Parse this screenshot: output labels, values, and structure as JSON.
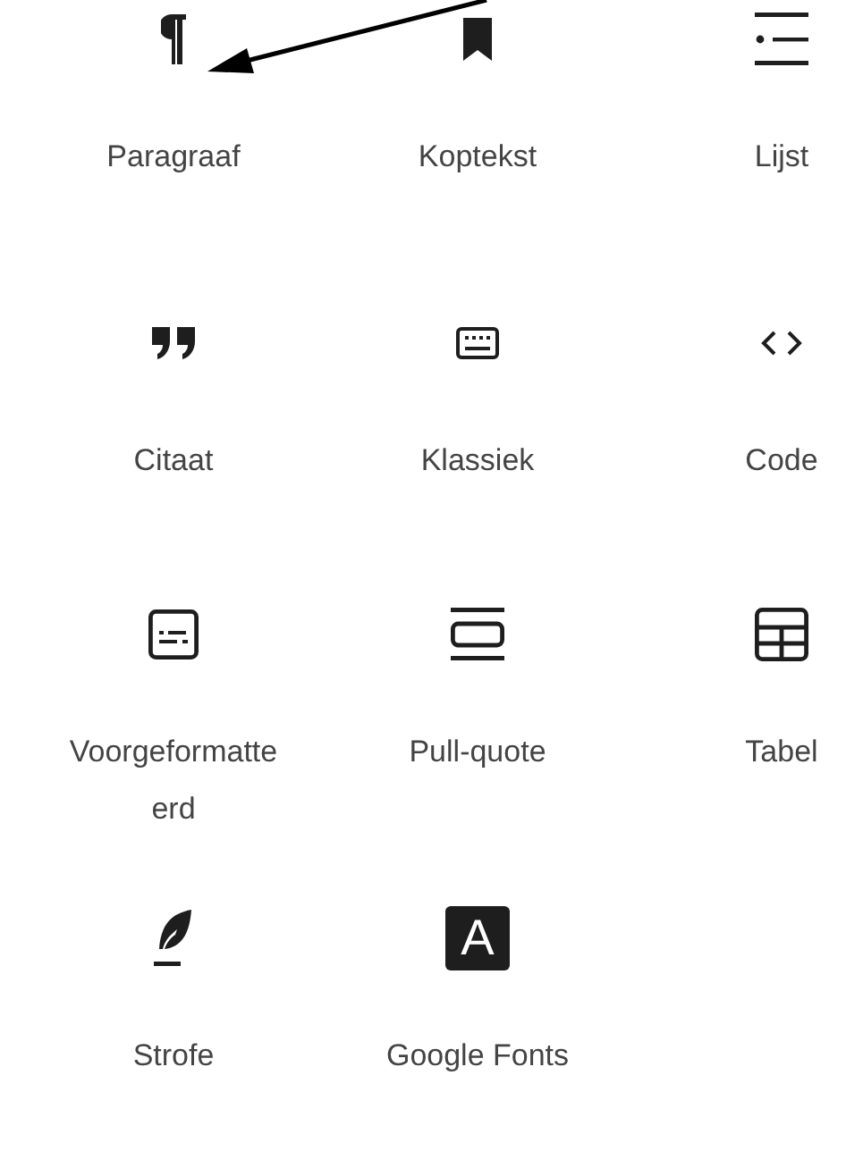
{
  "blocks": [
    {
      "kind": "paragraph",
      "label": "Paragraaf"
    },
    {
      "kind": "heading",
      "label": "Koptekst"
    },
    {
      "kind": "list",
      "label": "Lijst"
    },
    {
      "kind": "quote",
      "label": "Citaat"
    },
    {
      "kind": "classic",
      "label": "Klassiek"
    },
    {
      "kind": "code",
      "label": "Code"
    },
    {
      "kind": "preformatted",
      "label": "Voorgeformatteerd"
    },
    {
      "kind": "pullquote",
      "label": "Pull-quote"
    },
    {
      "kind": "table",
      "label": "Tabel"
    },
    {
      "kind": "verse",
      "label": "Strofe"
    },
    {
      "kind": "letter",
      "label": "Google Fonts",
      "glyph": "A"
    }
  ],
  "annotation": {
    "kind": "arrow"
  }
}
